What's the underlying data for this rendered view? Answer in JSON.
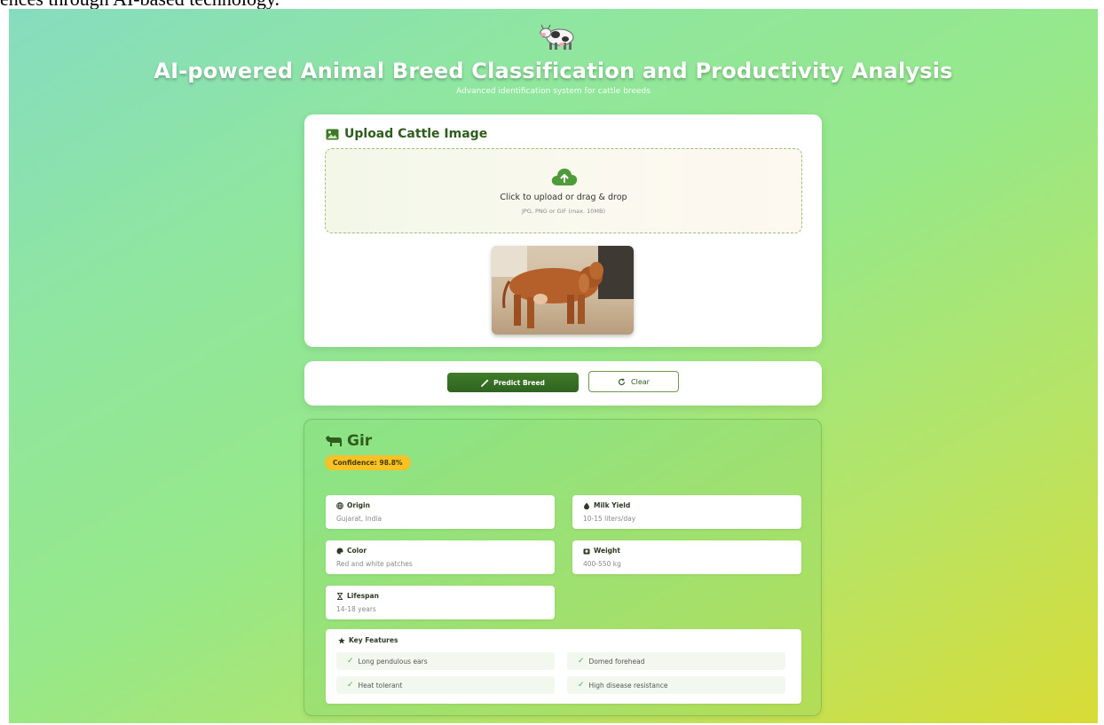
{
  "caption": "ences through AI-based technology.",
  "header": {
    "title": "AI-powered Animal Breed Classification and Productivity Analysis",
    "subtitle": "Advanced identification system for cattle breeds"
  },
  "upload": {
    "heading": "Upload Cattle Image",
    "drop_text": "Click to upload or drag & drop",
    "drop_hint": "JPG, PNG or GIF (max. 10MB)"
  },
  "actions": {
    "predict_label": "Predict Breed",
    "clear_label": "Clear"
  },
  "result": {
    "breed": "Gir",
    "confidence": "Confidence: 98.8%",
    "info": [
      {
        "label": "Origin",
        "value": "Gujarat, India",
        "icon": "globe-icon"
      },
      {
        "label": "Milk Yield",
        "value": "10-15 liters/day",
        "icon": "droplet-icon"
      },
      {
        "label": "Color",
        "value": "Red and white patches",
        "icon": "palette-icon"
      },
      {
        "label": "Weight",
        "value": "400-550 kg",
        "icon": "scale-icon"
      },
      {
        "label": "Lifespan",
        "value": "14-18 years",
        "icon": "hourglass-icon"
      }
    ],
    "features_title": "Key Features",
    "features": [
      "Long pendulous ears",
      "Domed forehead",
      "Heat tolerant",
      "High disease resistance"
    ]
  },
  "colors": {
    "accent": "#2f6320",
    "badge": "#f6c226",
    "check": "#4caf50"
  }
}
